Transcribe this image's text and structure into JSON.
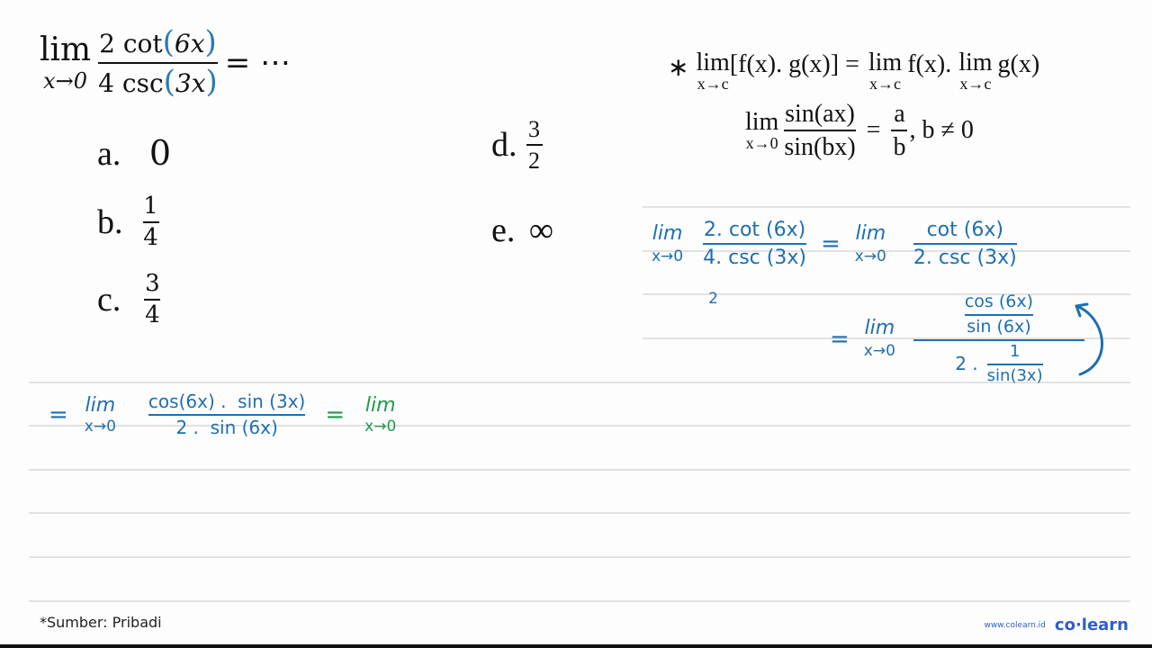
{
  "question": {
    "lim_word": "lim",
    "lim_sub": "x→0",
    "numerator_pre": "2 cot",
    "numerator_arg": "6x",
    "denominator_pre": "4 csc",
    "denominator_arg": "3x",
    "tail": "= ⋯"
  },
  "options": [
    {
      "label": "a.",
      "value": "0"
    },
    {
      "label": "b.",
      "num": "1",
      "den": "4"
    },
    {
      "label": "c.",
      "num": "3",
      "den": "4"
    },
    {
      "label": "d.",
      "num": "3",
      "den": "2"
    },
    {
      "label": "e.",
      "value": "∞"
    }
  ],
  "formulas": {
    "product_rule": {
      "star": "∗",
      "lim_word": "lim",
      "lim_sub": "x→c",
      "lhs": "[f(x). g(x)] =",
      "rhs1": "f(x).",
      "rhs2": "g(x)"
    },
    "sin_ratio": {
      "lim_word": "lim",
      "lim_sub": "x→0",
      "num": "sin(ax)",
      "den": "sin(bx)",
      "eq": "=",
      "res_num": "a",
      "res_den": "b",
      "cond": ", b ≠ 0"
    }
  },
  "handwriting": {
    "step1": {
      "lim_word": "lim",
      "lim_sub": "x→0",
      "num": "2. cot (6x)",
      "den": "4. csc (3x)",
      "den_note": "2",
      "eq": "=",
      "lim2_word": "lim",
      "lim2_sub": "x→0",
      "num2": "cot (6x)",
      "den2": "2. csc (3x)"
    },
    "step2": {
      "eq": "=",
      "lim_word": "lim",
      "lim_sub": "x→0",
      "inner_num": "cos (6x)",
      "inner_den": "sin (6x)",
      "den_pre": "2 .",
      "den_inner_num": "1",
      "den_inner_den": "sin(3x)"
    },
    "step3": {
      "eq": "=",
      "lim_word": "lim",
      "lim_sub": "x→0",
      "num": "cos(6x) .  sin (3x)",
      "den": "2 .  sin (6x)",
      "eq2": "=",
      "lim2_word": "lim",
      "lim2_sub": "x→0"
    }
  },
  "footer": {
    "source": "*Sumber: Pribadi",
    "website": "www.colearn.id",
    "brand": "co·learn"
  },
  "colors": {
    "ink_blue": "#1e6fb0",
    "ink_green": "#1f9a4a",
    "brand_blue": "#2f5fc4"
  }
}
